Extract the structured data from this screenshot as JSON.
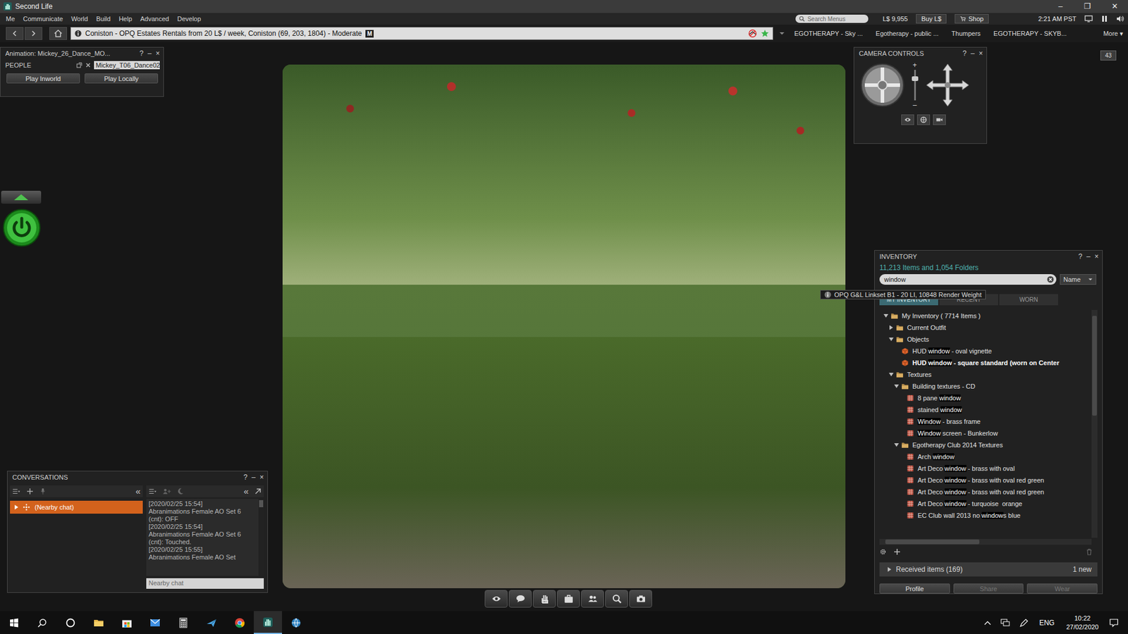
{
  "window": {
    "title": "Second Life",
    "controls": [
      "–",
      "❐",
      "✕"
    ]
  },
  "menu": [
    "Me",
    "Communicate",
    "World",
    "Build",
    "Help",
    "Advanced",
    "Develop"
  ],
  "status": {
    "search_placeholder": "Search Menus",
    "balance": "L$ 9,955",
    "buy": "Buy L$",
    "shop": "Shop",
    "time": "2:21 AM PST"
  },
  "nav": {
    "location": "Coniston - OPQ Estates Rentals from 20 L$ / week, Coniston (69, 203, 1804) - Moderate",
    "rating": "M",
    "favorites": [
      "EGOTHERAPY - Sky ...",
      "Egotherapy - public ...",
      "Thumpers",
      "EGOTHERAPY - SKYB..."
    ],
    "more": "More ▾"
  },
  "floater_controls": [
    "?",
    "–",
    "×"
  ],
  "animation": {
    "title": "Animation: Mickey_26_Dance_MO...",
    "tab": "PEOPLE",
    "field": "Mickey_T06_Dance02",
    "buttons": [
      "Play Inworld",
      "Play Locally"
    ]
  },
  "camera": {
    "title": "CAMERA CONTROLS",
    "zoom_plus": "+",
    "zoom_minus": "–",
    "zoom_level": 0.75
  },
  "hud_badge": "43",
  "tooltip": "OPQ G&L Linkset B1 - 20 LI, 10848 Render Weight",
  "inventory": {
    "title": "INVENTORY",
    "summary": "11,213 Items and 1,054 Folders",
    "search": "window",
    "sort": "Name",
    "tabs": [
      {
        "label": "MY INVENTORY",
        "selected": true
      },
      {
        "label": "RECENT",
        "selected": false
      },
      {
        "label": "WORN",
        "selected": false
      }
    ],
    "rows": [
      {
        "depth": 0,
        "kind": "folder",
        "expanded": true,
        "parts": [
          {
            "text": "My Inventory ( 7714 Items )",
            "match": false
          }
        ]
      },
      {
        "depth": 1,
        "kind": "folder",
        "expanded": false,
        "parts": [
          {
            "text": "Current Outfit",
            "match": false
          }
        ]
      },
      {
        "depth": 1,
        "kind": "folder",
        "expanded": true,
        "parts": [
          {
            "text": "Objects",
            "match": false
          }
        ]
      },
      {
        "depth": 2,
        "kind": "object",
        "worn": false,
        "parts": [
          {
            "text": "HUD ",
            "match": false
          },
          {
            "text": "window",
            "match": true
          },
          {
            "text": " - oval vignette",
            "match": false
          }
        ]
      },
      {
        "depth": 2,
        "kind": "object",
        "worn": true,
        "parts": [
          {
            "text": "HUD ",
            "match": false
          },
          {
            "text": "window",
            "match": true
          },
          {
            "text": " - square standard (worn on Center",
            "match": false
          }
        ]
      },
      {
        "depth": 1,
        "kind": "folder",
        "expanded": true,
        "parts": [
          {
            "text": "Textures",
            "match": false
          }
        ]
      },
      {
        "depth": 2,
        "kind": "folder",
        "expanded": true,
        "parts": [
          {
            "text": "Building textures - CD",
            "match": false
          }
        ]
      },
      {
        "depth": 3,
        "kind": "texture",
        "parts": [
          {
            "text": "8 pane ",
            "match": false
          },
          {
            "text": "window",
            "match": true
          }
        ]
      },
      {
        "depth": 3,
        "kind": "texture",
        "parts": [
          {
            "text": "stained ",
            "match": false
          },
          {
            "text": "window",
            "match": true
          }
        ]
      },
      {
        "depth": 3,
        "kind": "texture",
        "parts": [
          {
            "text": "Window",
            "match": true
          },
          {
            "text": " - brass frame",
            "match": false
          }
        ]
      },
      {
        "depth": 3,
        "kind": "texture",
        "parts": [
          {
            "text": "Window",
            "match": true
          },
          {
            "text": " screen - Bunkerlow",
            "match": false
          }
        ]
      },
      {
        "depth": 2,
        "kind": "folder",
        "expanded": true,
        "parts": [
          {
            "text": "Egotherapy Club 2014 Textures",
            "match": false
          }
        ]
      },
      {
        "depth": 3,
        "kind": "texture",
        "parts": [
          {
            "text": "Arch ",
            "match": false
          },
          {
            "text": "window",
            "match": true
          }
        ]
      },
      {
        "depth": 3,
        "kind": "texture",
        "parts": [
          {
            "text": "Art Deco ",
            "match": false
          },
          {
            "text": "window",
            "match": true
          },
          {
            "text": " - brass with oval",
            "match": false
          }
        ]
      },
      {
        "depth": 3,
        "kind": "texture",
        "parts": [
          {
            "text": "Art Deco ",
            "match": false
          },
          {
            "text": "window",
            "match": true
          },
          {
            "text": " - brass with oval red green",
            "match": false
          }
        ]
      },
      {
        "depth": 3,
        "kind": "texture",
        "parts": [
          {
            "text": "Art Deco ",
            "match": false
          },
          {
            "text": "window",
            "match": true
          },
          {
            "text": " - brass with oval red green",
            "match": false
          }
        ]
      },
      {
        "depth": 3,
        "kind": "texture",
        "parts": [
          {
            "text": "Art Deco ",
            "match": false
          },
          {
            "text": "window",
            "match": true
          },
          {
            "text": " - turquoise  orange",
            "match": false
          }
        ]
      },
      {
        "depth": 3,
        "kind": "texture",
        "parts": [
          {
            "text": "EC Club wall 2013 no ",
            "match": false
          },
          {
            "text": "window",
            "match": true
          },
          {
            "text": "s blue",
            "match": false
          }
        ]
      }
    ],
    "received": {
      "label": "Received items (169)",
      "badge": "1 new",
      "expanded": false
    },
    "buttons": [
      {
        "label": "Profile",
        "disabled": false
      },
      {
        "label": "Share",
        "disabled": true
      },
      {
        "label": "Wear",
        "disabled": true
      }
    ]
  },
  "conversations": {
    "title": "CONVERSATIONS",
    "collapse": "«",
    "list": [
      {
        "label": "(Nearby chat)",
        "selected": true
      }
    ],
    "log": [
      {
        "time": "[2020/02/25 15:54]",
        "text": "Abranimations Female AO Set 6 (cnt): OFF"
      },
      {
        "time": "[2020/02/25 15:54]",
        "text": "Abranimations Female AO Set 6 (cnt): Touched."
      },
      {
        "time": "[2020/02/25 15:55]",
        "text": "Abranimations Female AO Set"
      }
    ],
    "input_placeholder": "Nearby chat"
  },
  "taskbar": {
    "language": "ENG",
    "time": "10:22",
    "date": "27/02/2020"
  }
}
